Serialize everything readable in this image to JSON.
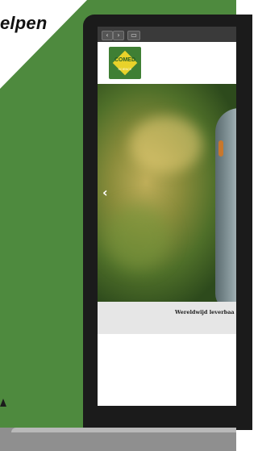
{
  "headline": "elpen",
  "browser": {
    "back_glyph": "‹",
    "forward_glyph": "›",
    "sidebar_glyph": "▭"
  },
  "site": {
    "logo_text": "COMED",
    "logo_subtext": "SCIENCE",
    "hero_prev_glyph": "‹",
    "banner_text": "Wereldwijd leverbaa"
  },
  "colors": {
    "background_green": "#4e8a3e",
    "logo_green": "#3f7f34",
    "logo_yellow": "#e9d22a"
  }
}
